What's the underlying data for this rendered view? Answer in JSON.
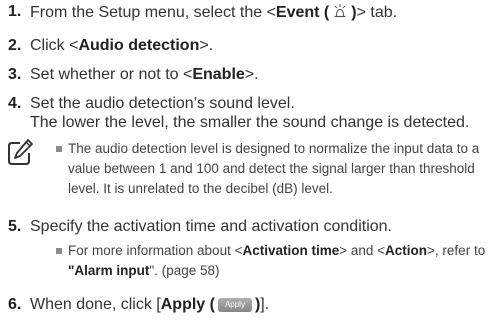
{
  "steps": [
    {
      "num": "1.",
      "a": "From the Setup menu, select the <",
      "b": "Event (",
      "c": ")",
      "d": "> tab.",
      "icon": "event-alarm-icon"
    },
    {
      "num": "2.",
      "a": "Click <",
      "b": "Audio detection",
      "c": ">."
    },
    {
      "num": "3.",
      "a": "Set whether or not to <",
      "b": "Enable",
      "c": ">."
    },
    {
      "num": "4.",
      "a": "Set the audio detection’s sound level.",
      "line2": "The lower the level, the smaller the sound change is detected."
    },
    {
      "num": "5.",
      "a": "Specify the activation time and activation condition."
    },
    {
      "num": "6.",
      "a": "When done, click [",
      "b": "Apply (",
      "btn": "Apply",
      "c": ")",
      "d": "]."
    }
  ],
  "note": {
    "icon": "note-pencil-icon",
    "lines": [
      "The audio detection level is designed to normalize the input data to a",
      "value between 1 and 100 and detect the signal larger than threshold",
      "level. It is unrelated to the decibel (dB) level."
    ]
  },
  "step5_bullet": {
    "l1a": "For more information about <",
    "l1b": "Activation time",
    "l1c": "> and <",
    "l1d": "Action",
    "l1e": ">, refer to",
    "l2a": "\"",
    "l2b": "Alarm input",
    "l2c": "\". (page 58)"
  }
}
